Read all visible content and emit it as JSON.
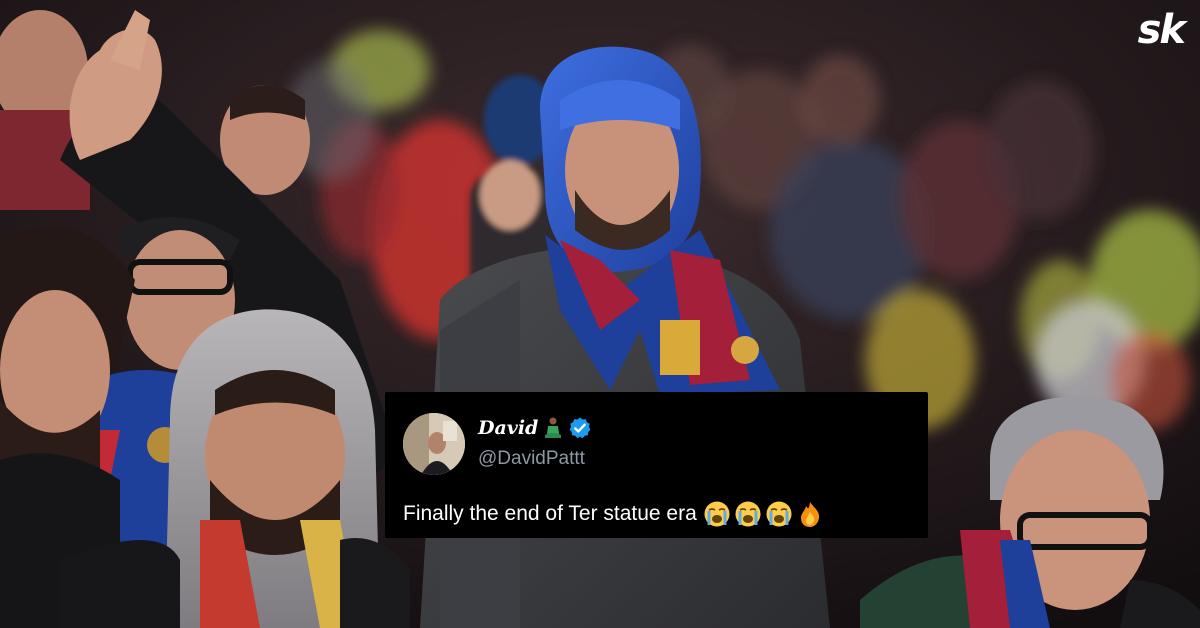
{
  "logo": {
    "text": "sk"
  },
  "tweet": {
    "display_name": "David",
    "handle": "@DavidPattt",
    "text": "Finally the end of Ter statue era",
    "emojis": [
      "loudly-crying-face-icon",
      "loudly-crying-face-icon",
      "loudly-crying-face-icon",
      "fire-icon"
    ],
    "verified_color": "#1d9bf0"
  },
  "colors": {
    "tweet_background": "#000000",
    "handle_gray": "#8b98a5",
    "barca_blue": "#1e3f9a",
    "barca_red": "#a41f3a",
    "hood_blue": "#2f5bc8"
  }
}
